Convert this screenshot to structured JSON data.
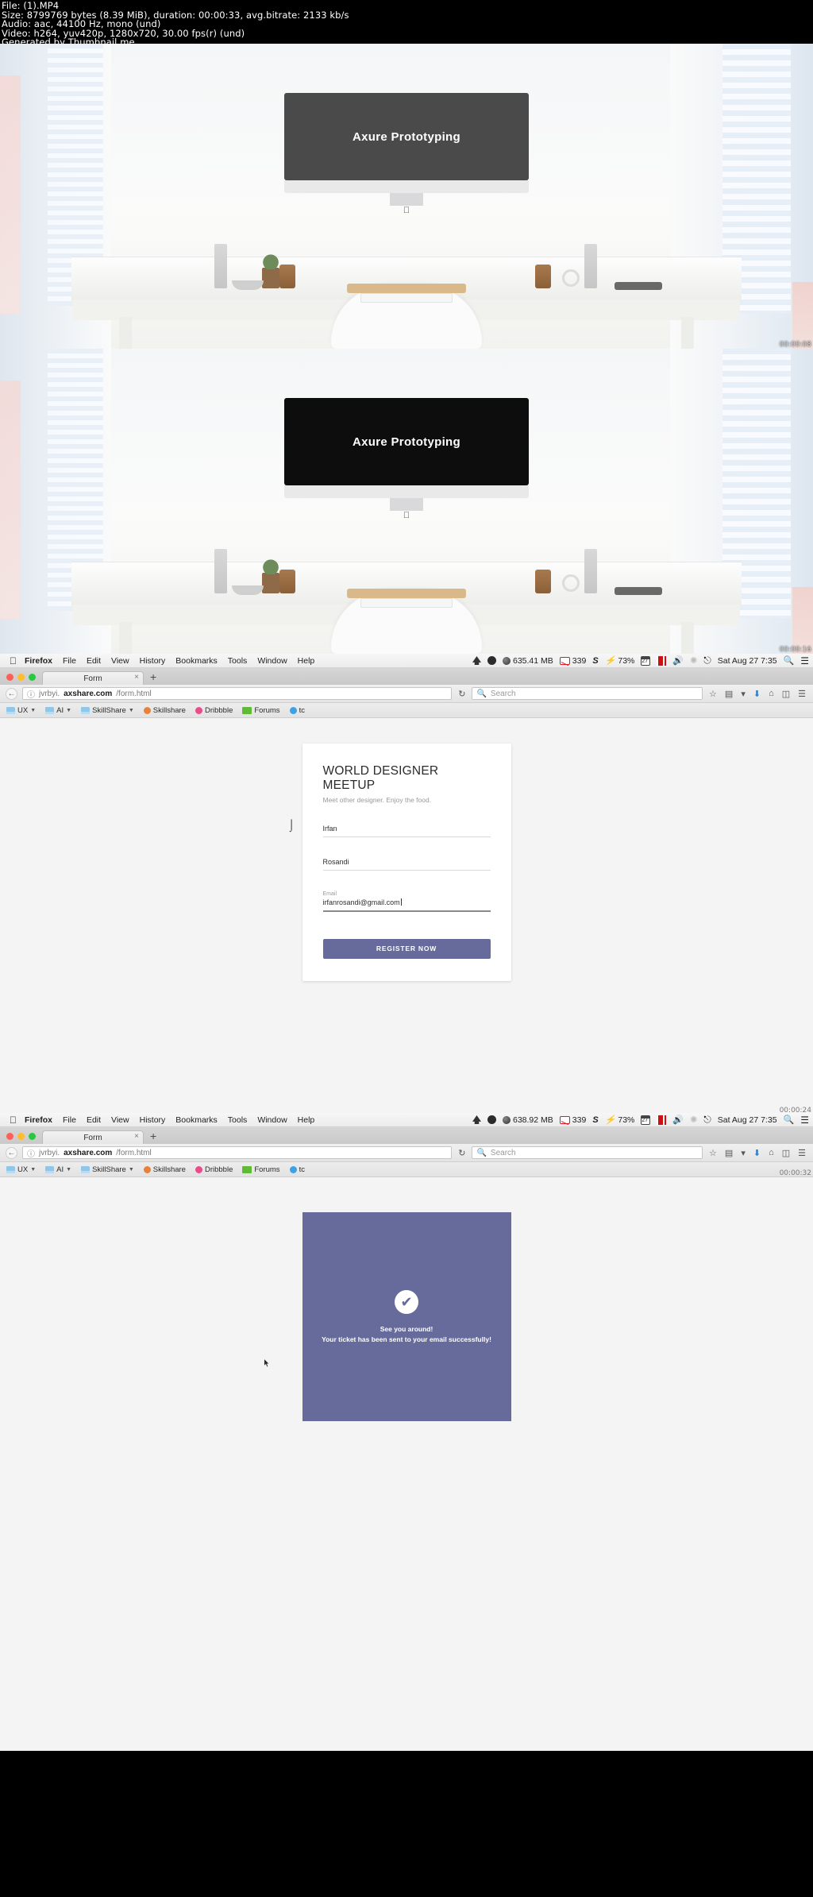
{
  "metadata": {
    "line1": "File:  (1).MP4",
    "line2": "Size: 8799769 bytes (8.39 MiB), duration: 00:00:33, avg.bitrate: 2133 kb/s",
    "line3": "Audio: aac, 44100 Hz, mono (und)",
    "line4": "Video: h264, yuv420p, 1280x720, 30.00 fps(r) (und)",
    "line5": "Generated by Thumbnail me"
  },
  "frames": [
    {
      "screen_text": "Axure Prototyping",
      "timestamp": "00:00:08",
      "screen_color": "#4a4a4a"
    },
    {
      "screen_text": "Axure Prototyping",
      "timestamp": "00:00:16",
      "screen_color": "#0d0d0d"
    }
  ],
  "browsers": [
    {
      "timestamp": "00:00:24",
      "menubar": {
        "apple": "apple-logo",
        "items": [
          "Firefox",
          "File",
          "Edit",
          "View",
          "History",
          "Bookmarks",
          "Tools",
          "Window",
          "Help"
        ],
        "status": {
          "memory": "635.41 MB",
          "mail_count": "339",
          "battery": "73%",
          "calendar_day": "27",
          "datetime": "Sat Aug 27  7:35"
        }
      },
      "tab": {
        "title": "Form",
        "close": "×",
        "newtab": "+"
      },
      "nav": {
        "url_prefix": "jvrbyi.",
        "url_domain": "axshare.com",
        "url_path": "/form.html",
        "search_placeholder": "Search",
        "reload": "↻",
        "back": "←",
        "info": "ⓘ"
      },
      "bookmarks": [
        {
          "label": "UX",
          "icon": "folder-icon",
          "caret": true
        },
        {
          "label": "AI",
          "icon": "folder-icon",
          "caret": true
        },
        {
          "label": "SkillShare",
          "icon": "folder-icon",
          "caret": true
        },
        {
          "label": "Skillshare",
          "icon": "circle-icon",
          "color": "#e8813a"
        },
        {
          "label": "Dribbble",
          "icon": "circle-icon",
          "color": "#ea4c89"
        },
        {
          "label": "Forums",
          "icon": "flag-icon",
          "color": "#5fbb36"
        },
        {
          "label": "tc",
          "icon": "circle-icon",
          "color": "#3aa3e8"
        }
      ]
    },
    {
      "timestamp": "00:00:32",
      "menubar": {
        "apple": "apple-logo",
        "items": [
          "Firefox",
          "File",
          "Edit",
          "View",
          "History",
          "Bookmarks",
          "Tools",
          "Window",
          "Help"
        ],
        "status": {
          "memory": "638.92 MB",
          "mail_count": "339",
          "battery": "73%",
          "calendar_day": "27",
          "datetime": "Sat Aug 27  7:35"
        }
      },
      "tab": {
        "title": "Form",
        "close": "×",
        "newtab": "+"
      },
      "nav": {
        "url_prefix": "jvrbyi.",
        "url_domain": "axshare.com",
        "url_path": "/form.html",
        "search_placeholder": "Search",
        "reload": "↻",
        "back": "←",
        "info": "ⓘ"
      },
      "bookmarks": [
        {
          "label": "UX",
          "icon": "folder-icon",
          "caret": true
        },
        {
          "label": "AI",
          "icon": "folder-icon",
          "caret": true
        },
        {
          "label": "SkillShare",
          "icon": "folder-icon",
          "caret": true
        },
        {
          "label": "Skillshare",
          "icon": "circle-icon",
          "color": "#e8813a"
        },
        {
          "label": "Dribbble",
          "icon": "circle-icon",
          "color": "#ea4c89"
        },
        {
          "label": "Forums",
          "icon": "flag-icon",
          "color": "#5fbb36"
        },
        {
          "label": "tc",
          "icon": "circle-icon",
          "color": "#3aa3e8"
        }
      ]
    }
  ],
  "form": {
    "title": "WORLD DESIGNER MEETUP",
    "subtitle": "Meet other designer. Enjoy the food.",
    "fields": [
      {
        "label": "",
        "value": "Irfan"
      },
      {
        "label": "",
        "value": "Rosandi"
      },
      {
        "label": "Email",
        "value": "irfanrosandi@gmail.com"
      }
    ],
    "submit_label": "REGISTER NOW"
  },
  "success": {
    "icon": "check-icon",
    "line1": "See you around!",
    "line2": "Your ticket has been sent to your email successfully!"
  },
  "colors": {
    "accent": "#676b9c",
    "page_bg": "#f4f4f4",
    "card_bg": "#ffffff"
  }
}
